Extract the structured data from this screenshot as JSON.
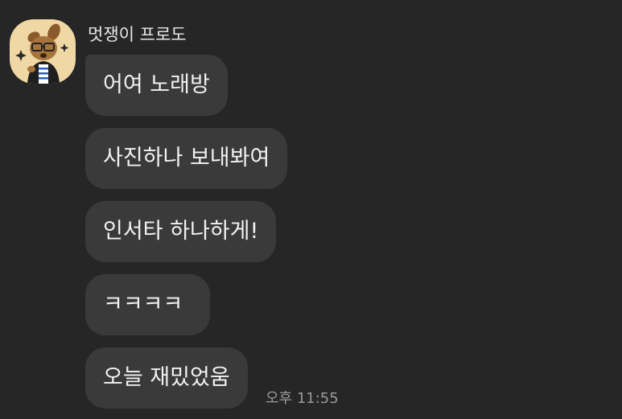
{
  "chat": {
    "sender_name": "멋쟁이 프로도",
    "avatar_icon": "frodo-character-icon",
    "messages": [
      {
        "text": "어여 노래방"
      },
      {
        "text": "사진하나 보내봐여"
      },
      {
        "text": "인서타 하나하게!"
      },
      {
        "text": "ㅋㅋㅋㅋ"
      },
      {
        "text": "오늘 재밌었움"
      }
    ],
    "timestamp": "오후 11:55"
  },
  "colors": {
    "background": "#262626",
    "bubble": "#3a3a3a",
    "text": "#f2f2f2",
    "timestamp": "#9a9a9a",
    "avatar_bg": "#efd8a4"
  }
}
